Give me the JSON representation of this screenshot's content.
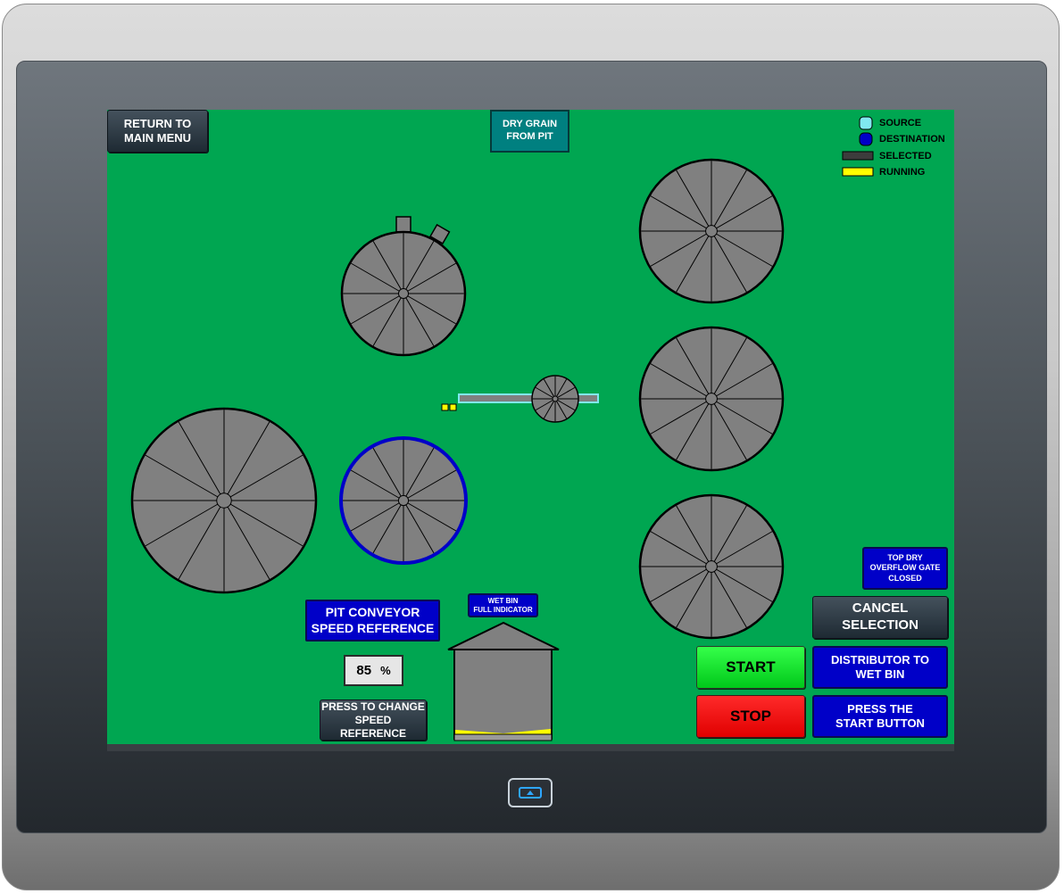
{
  "header": {
    "return_button": "RETURN TO\nMAIN MENU",
    "mode_label": "DRY GRAIN\nFROM PIT"
  },
  "legend": {
    "source": "SOURCE",
    "destination": "DESTINATION",
    "selected": "SELECTED",
    "running": "RUNNING"
  },
  "colors": {
    "screen_bg": "#00a651",
    "bin_fill": "#808080",
    "source": "#80e8f0",
    "destination": "#0000c8",
    "selected": "#3c3c3c",
    "running": "#ffff00",
    "conveyor_outline": "#80e8f0"
  },
  "speed": {
    "title": "PIT CONVEYOR\nSPEED REFERENCE",
    "value": "85",
    "unit": "%",
    "change_button": "PRESS TO CHANGE\nSPEED REFERENCE"
  },
  "wet_bin": {
    "indicator_label": "WET BIN\nFULL INDICATOR"
  },
  "status": {
    "gate": "TOP DRY\nOVERFLOW GATE\nCLOSED",
    "route": "DISTRIBUTOR TO\nWET BIN",
    "prompt": "PRESS THE\nSTART BUTTON"
  },
  "controls": {
    "cancel": "CANCEL\nSELECTION",
    "start": "START",
    "stop": "STOP"
  },
  "icons": {
    "home": "home-icon"
  }
}
